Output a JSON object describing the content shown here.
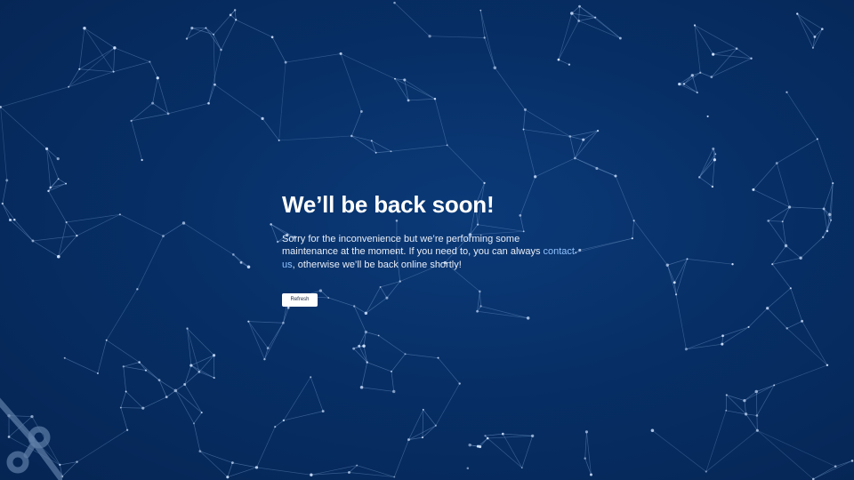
{
  "page": {
    "title": "We’ll be back soon!",
    "message_before_link": "Sorry for the inconvenience but we’re performing some maintenance at the moment. If you need to, you can always ",
    "link_text": "contact us",
    "message_after_link": ", otherwise we’ll be back online shortly!",
    "refresh_label": "Refresh"
  },
  "colors": {
    "background": "#072f66",
    "heading": "#ffffff",
    "body_text": "#e8eef8",
    "link": "#8ec2ff",
    "button_background": "#ffffff",
    "network_lines": "#7fa6d8"
  },
  "icons": {
    "logo": "connector-logo-icon"
  }
}
